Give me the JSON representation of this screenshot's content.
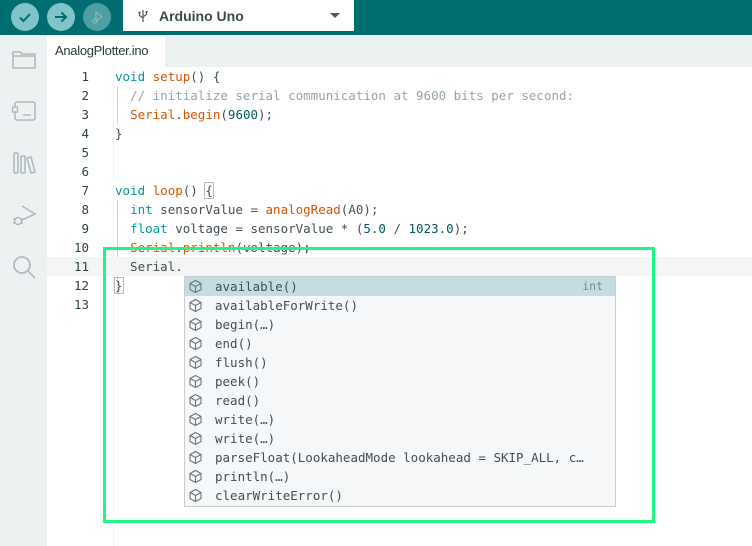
{
  "toolbar": {
    "verify_label": "Verify",
    "upload_label": "Upload",
    "debug_label": "Debug",
    "board": {
      "icon": "usb-icon",
      "selected": "Arduino Uno"
    }
  },
  "sidebar": {
    "items": [
      {
        "name": "sketchbook",
        "icon": "folder-icon"
      },
      {
        "name": "boards-manager",
        "icon": "board-icon"
      },
      {
        "name": "library-manager",
        "icon": "library-icon"
      },
      {
        "name": "debug",
        "icon": "debug-icon"
      },
      {
        "name": "search",
        "icon": "search-icon"
      }
    ]
  },
  "tabs": [
    {
      "label": "AnalogPlotter.ino",
      "active": true
    }
  ],
  "editor": {
    "line_numbers": [
      "1",
      "2",
      "3",
      "4",
      "5",
      "6",
      "7",
      "8",
      "9",
      "10",
      "11",
      "12",
      "13"
    ],
    "current_line": 11,
    "lines": [
      "void setup() {",
      "  // initialize serial communication at 9600 bits per second:",
      "  Serial.begin(9600);",
      "}",
      "",
      "",
      "void loop() {",
      "  int sensorValue = analogRead(A0);",
      "  float voltage = sensorValue * (5.0 / 1023.0);",
      "  Serial.println(voltage);",
      "  Serial.",
      "}",
      ""
    ]
  },
  "suggestions": {
    "icon": "method-cube-icon",
    "selected_index": 0,
    "items": [
      {
        "label": "available()",
        "type": "int"
      },
      {
        "label": "availableForWrite()",
        "type": ""
      },
      {
        "label": "begin(…)",
        "type": ""
      },
      {
        "label": "end()",
        "type": ""
      },
      {
        "label": "flush()",
        "type": ""
      },
      {
        "label": "peek()",
        "type": ""
      },
      {
        "label": "read()",
        "type": ""
      },
      {
        "label": "write(…)",
        "type": ""
      },
      {
        "label": "write(…)",
        "type": ""
      },
      {
        "label": "parseFloat(LookaheadMode lookahead = SKIP_ALL, c…",
        "type": ""
      },
      {
        "label": "println(…)",
        "type": ""
      },
      {
        "label": "clearWriteError()",
        "type": ""
      }
    ]
  },
  "colors": {
    "topbar": "#006d70",
    "button": "#7fc4c8",
    "sidebar": "#ecf1f1",
    "keyword": "#00979c",
    "function": "#d35400",
    "comment": "#95a5a6",
    "selection": "#c4dde1",
    "highlight_box": "#1ef583"
  }
}
